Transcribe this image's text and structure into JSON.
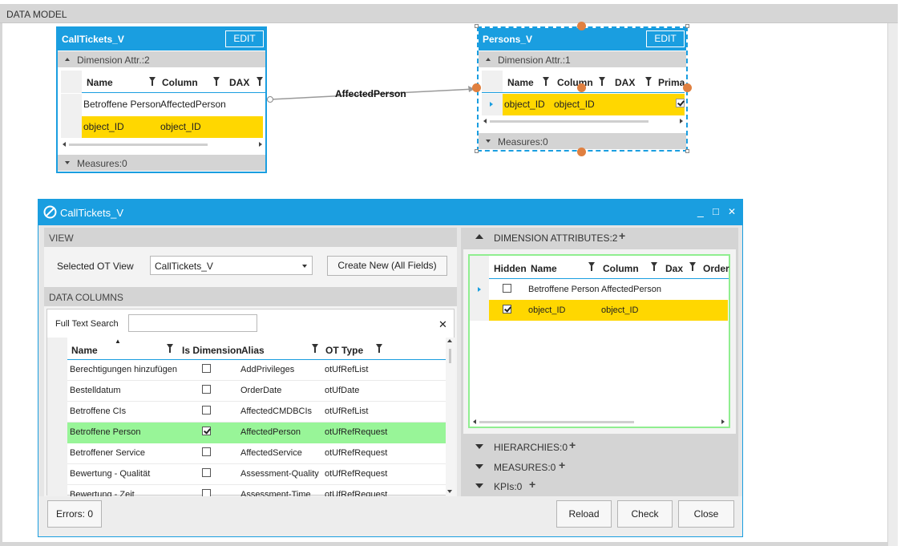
{
  "app": {
    "section_title": "DATA MODEL"
  },
  "entities": {
    "calltickets": {
      "title": "CallTickets_V",
      "edit_label": "EDIT",
      "dimension_label": "Dimension Attr.:2",
      "columns": [
        "Name",
        "Column",
        "DAX"
      ],
      "rows": [
        {
          "name": "Betroffene Person",
          "column": "AffectedPerson"
        },
        {
          "name": "object_ID",
          "column": "object_ID"
        }
      ],
      "measures_label": "Measures:0"
    },
    "persons": {
      "title": "Persons_V",
      "edit_label": "EDIT",
      "dimension_label": "Dimension Attr.:1",
      "columns": [
        "Name",
        "Column",
        "DAX",
        "Primar"
      ],
      "rows": [
        {
          "name": "object_ID",
          "column": "object_ID"
        }
      ],
      "measures_label": "Measures:0"
    }
  },
  "relationship": {
    "label": "AffectedPerson"
  },
  "dialog": {
    "title": "CallTickets_V",
    "view": {
      "header": "VIEW",
      "selected_ot_view_label": "Selected OT View",
      "selected_ot_view_value": "CallTickets_V",
      "create_new_label": "Create New (All Fields)"
    },
    "data_columns": {
      "header": "DATA COLUMNS",
      "search_label": "Full Text Search",
      "search_value": "",
      "clear_label": "✕",
      "columns": [
        "Name",
        "Is Dimension",
        "Alias",
        "OT Type"
      ],
      "rows": [
        {
          "name": "Berechtigungen hinzufügen",
          "is_dimension": false,
          "alias": "AddPrivileges",
          "ot_type": "otUfRefList"
        },
        {
          "name": "Bestelldatum",
          "is_dimension": false,
          "alias": "OrderDate",
          "ot_type": "otUfDate"
        },
        {
          "name": "Betroffene CIs",
          "is_dimension": false,
          "alias": "AffectedCMDBCIs",
          "ot_type": "otUfRefList"
        },
        {
          "name": "Betroffene Person",
          "is_dimension": true,
          "alias": "AffectedPerson",
          "ot_type": "otUfRefRequest"
        },
        {
          "name": "Betroffener Service",
          "is_dimension": false,
          "alias": "AffectedService",
          "ot_type": "otUfRefRequest"
        },
        {
          "name": "Bewertung - Qualität",
          "is_dimension": false,
          "alias": "Assessment-Quality",
          "ot_type": "otUfRefRequest"
        },
        {
          "name": "Bewertung - Zeit",
          "is_dimension": false,
          "alias": "Assessment-Time",
          "ot_type": "otUfRefRequest"
        }
      ]
    },
    "dimension_attributes": {
      "header": "DIMENSION ATTRIBUTES:2",
      "columns": [
        "Hidden",
        "Name",
        "Column",
        "Dax",
        "Order"
      ],
      "rows": [
        {
          "hidden": false,
          "name": "Betroffene Person",
          "column": "AffectedPerson"
        },
        {
          "hidden": true,
          "name": "object_ID",
          "column": "object_ID"
        }
      ]
    },
    "hierarchies_label": "HIERARCHIES:0",
    "measures_label": "MEASURES:0",
    "kpis_label": "KPIs:0",
    "errors_label": "Errors: 0",
    "buttons": {
      "reload": "Reload",
      "check": "Check",
      "close": "Close"
    },
    "window_controls": {
      "minimize": "_",
      "maximize": "□",
      "close": "✕"
    }
  },
  "colors": {
    "accent": "#1a9ee0",
    "highlight_yellow": "#ffd700",
    "highlight_green": "#98f598"
  }
}
